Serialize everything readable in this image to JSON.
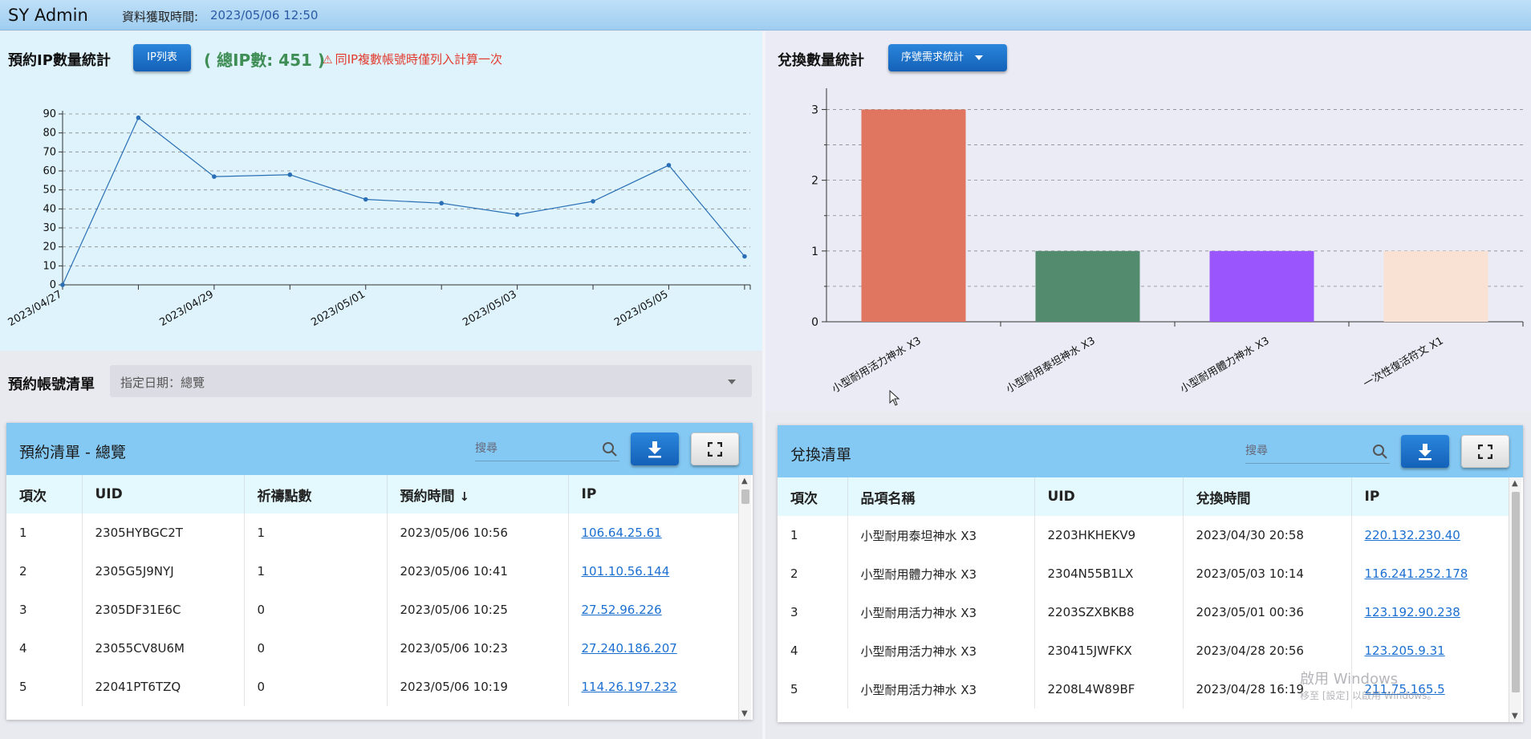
{
  "header": {
    "brand": "SY Admin",
    "fetch_label": "資料獲取時間:",
    "fetch_time": "2023/05/06 12:50"
  },
  "ip_stats": {
    "title": "預約IP數量統計",
    "ip_list_button": "IP列表",
    "total_ip": "( 總IP數: 451 )",
    "warning": "同IP複數帳號時僅列入計算一次",
    "warning_icon": "warning-triangle-icon"
  },
  "chart_data": [
    {
      "type": "line",
      "x_ticks": [
        "2023/04/27",
        "2023/04/29",
        "2023/05/01",
        "2023/05/03",
        "2023/05/05"
      ],
      "x": [
        "2023/04/27",
        "2023/04/28",
        "2023/04/29",
        "2023/04/30",
        "2023/05/01",
        "2023/05/02",
        "2023/05/03",
        "2023/05/04",
        "2023/05/05",
        "2023/05/06"
      ],
      "values": [
        0,
        88,
        57,
        58,
        45,
        43,
        37,
        44,
        63,
        15
      ],
      "yticks": [
        0,
        10,
        20,
        30,
        40,
        50,
        60,
        70,
        80,
        90
      ],
      "ylim": [
        0,
        90
      ],
      "grid": true,
      "color": "#2a6fb5"
    },
    {
      "type": "bar",
      "categories": [
        "小型耐用活力神水 X3",
        "小型耐用泰坦神水 X3",
        "小型耐用體力神水 X3",
        "一次性復活符文 X1"
      ],
      "values": [
        3,
        1,
        1,
        1
      ],
      "colors": [
        "#e0765f",
        "#538b6e",
        "#9b55fc",
        "#f9e1d4"
      ],
      "yticks": [
        0,
        1,
        2,
        3
      ],
      "ylim": [
        0,
        3.3
      ],
      "grid": true
    }
  ],
  "redeem_stats": {
    "title": "兌換數量統計",
    "dropdown_label": "序號需求統計"
  },
  "account_list": {
    "title": "預約帳號清單",
    "date_select": "指定日期：總覽"
  },
  "reserve_table": {
    "title": "預約清單 - 總覽",
    "search_placeholder": "搜尋",
    "columns": [
      "項次",
      "UID",
      "祈禱點數",
      "預約時間",
      "IP"
    ],
    "sort_icon": "arrow-down-icon",
    "rows": [
      {
        "no": "1",
        "uid": "2305HYBGC2T",
        "points": "1",
        "time": "2023/05/06 10:56",
        "ip": "106.64.25.61"
      },
      {
        "no": "2",
        "uid": "2305G5J9NYJ",
        "points": "1",
        "time": "2023/05/06 10:41",
        "ip": "101.10.56.144"
      },
      {
        "no": "3",
        "uid": "2305DF31E6C",
        "points": "0",
        "time": "2023/05/06 10:25",
        "ip": "27.52.96.226"
      },
      {
        "no": "4",
        "uid": "23055CV8U6M",
        "points": "0",
        "time": "2023/05/06 10:23",
        "ip": "27.240.186.207"
      },
      {
        "no": "5",
        "uid": "22041PT6TZQ",
        "points": "0",
        "time": "2023/05/06 10:19",
        "ip": "114.26.197.232"
      }
    ]
  },
  "redeem_table": {
    "title": "兌換清單",
    "search_placeholder": "搜尋",
    "columns": [
      "項次",
      "品項名稱",
      "UID",
      "兌換時間",
      "IP"
    ],
    "rows": [
      {
        "no": "1",
        "item": "小型耐用泰坦神水 X3",
        "uid": "2203HKHEKV9",
        "time": "2023/04/30 20:58",
        "ip": "220.132.230.40"
      },
      {
        "no": "2",
        "item": "小型耐用體力神水 X3",
        "uid": "2304N55B1LX",
        "time": "2023/05/03 10:14",
        "ip": "116.241.252.178"
      },
      {
        "no": "3",
        "item": "小型耐用活力神水 X3",
        "uid": "2203SZXBKB8",
        "time": "2023/05/01 00:36",
        "ip": "123.192.90.238"
      },
      {
        "no": "4",
        "item": "小型耐用活力神水 X3",
        "uid": "230415JWFKX",
        "time": "2023/04/28 20:56",
        "ip": "123.205.9.31"
      },
      {
        "no": "5",
        "item": "小型耐用活力神水 X3",
        "uid": "2208L4W89BF",
        "time": "2023/04/28 16:19",
        "ip": "211.75.165.5"
      }
    ]
  },
  "watermark": {
    "line1": "啟用 Windows",
    "line2": "移至 [設定] 以啟用 Windows。"
  }
}
